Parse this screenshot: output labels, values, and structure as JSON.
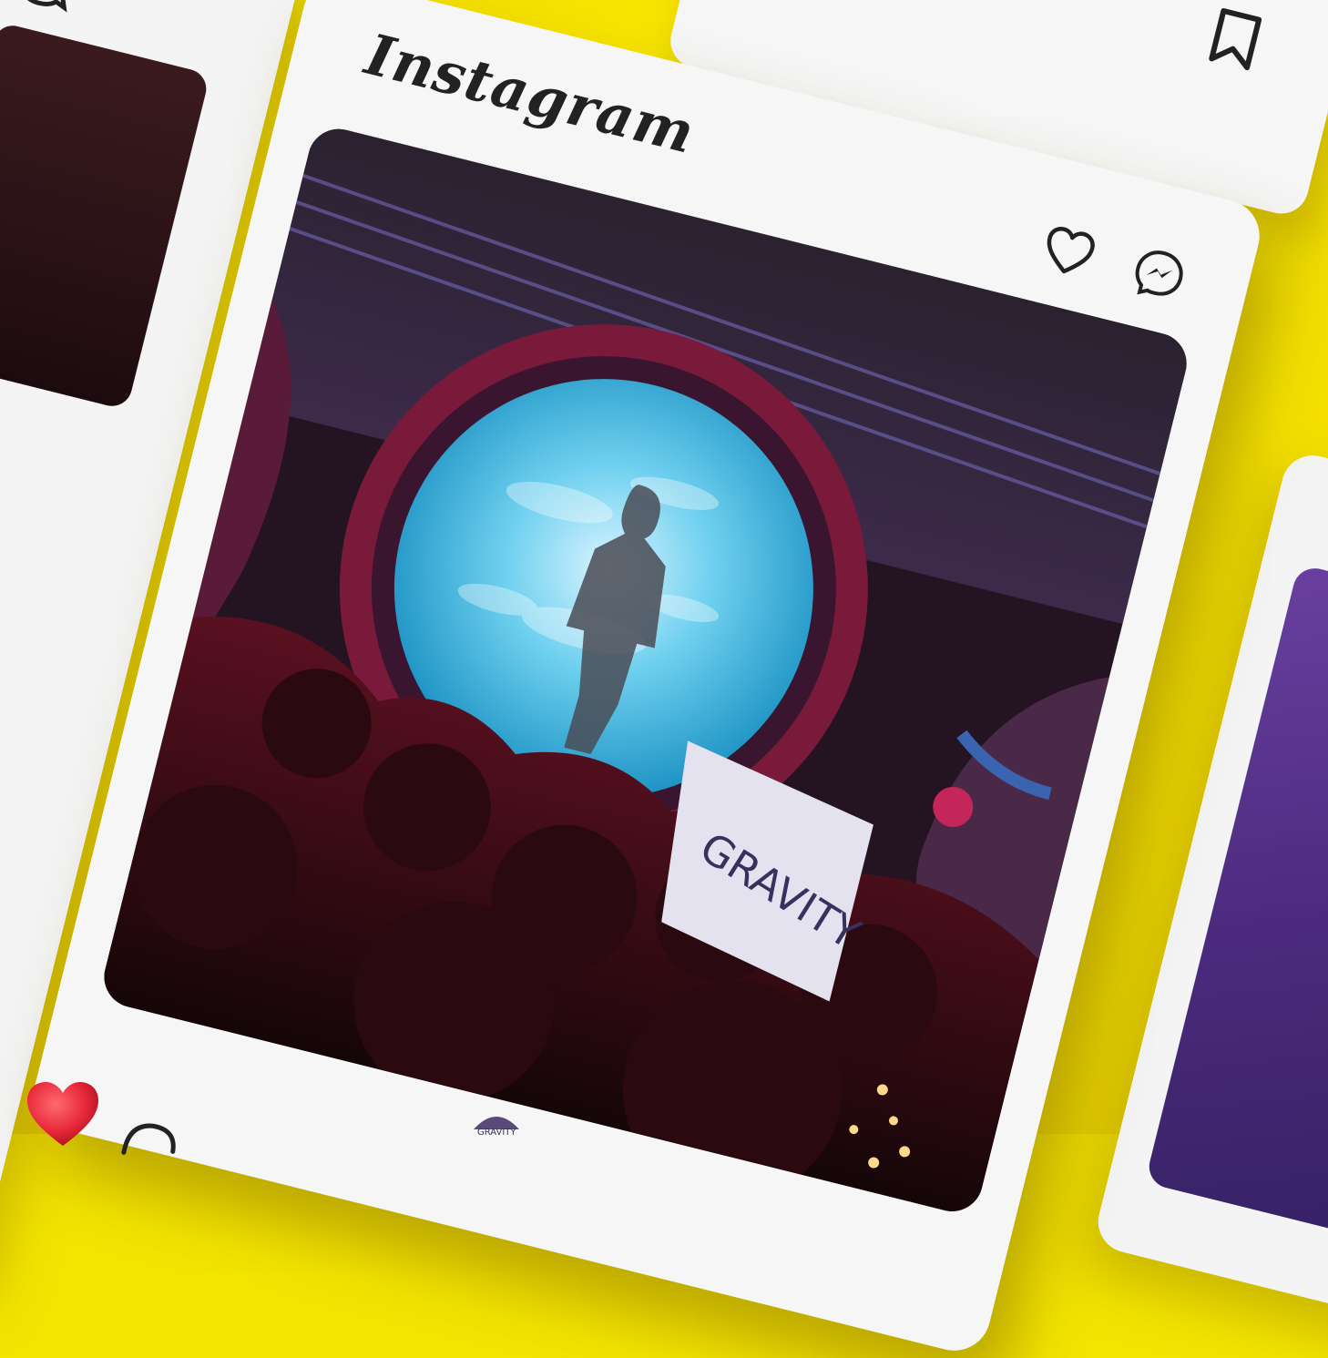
{
  "app": {
    "brand_name": "Instagram"
  },
  "post": {
    "flag_text": "GRAVITY",
    "footer_logo_text": "GRAVITY"
  },
  "icons": {
    "like": "heart-outline-icon",
    "messenger": "messenger-icon",
    "bookmark": "bookmark-icon",
    "comment": "comment-icon",
    "liked": "heart-filled-3d-icon"
  },
  "colors": {
    "background": "#f5e400",
    "card": "#f6f6f6",
    "icon": "#222222",
    "heart": "#e8283a"
  }
}
